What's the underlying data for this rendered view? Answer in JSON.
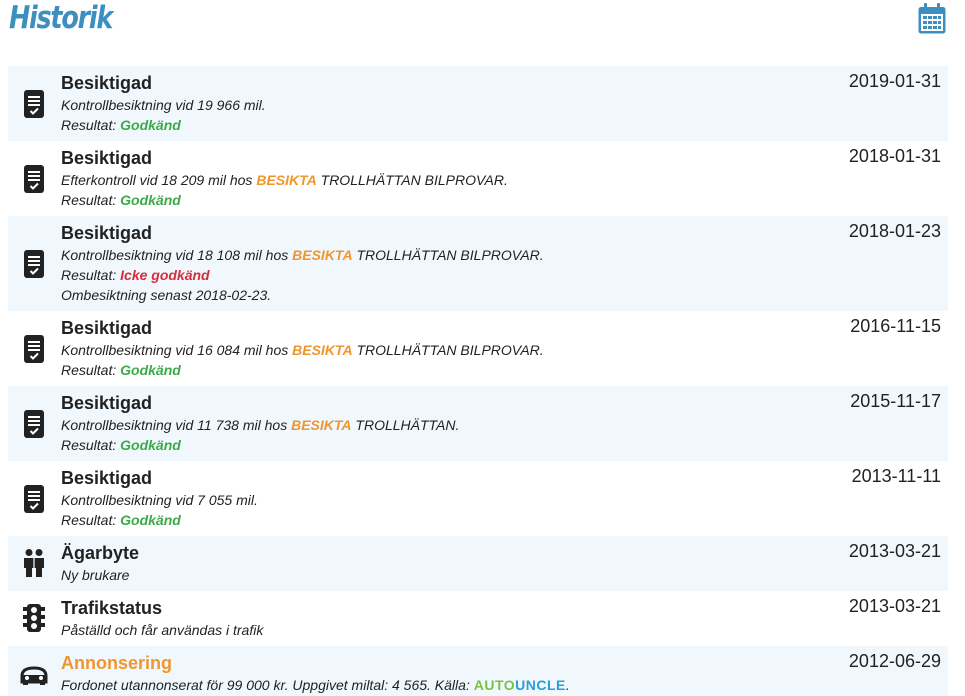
{
  "header": {
    "title": "Historik",
    "calendar_icon": "calendar-icon",
    "accent_color": "#3d8fbf"
  },
  "colors": {
    "ok": "#3daa4a",
    "fail": "#d62d3b",
    "link": "#f0962e",
    "row_alt": "#f0f8fd"
  },
  "events": [
    {
      "title": "Besiktigad",
      "date": "2019-01-31",
      "icon": "checklist-icon",
      "line1": "Kontrollbesiktning vid 19 966 mil.",
      "result_label": "Resultat:",
      "result": "Godkänd"
    },
    {
      "title": "Besiktigad",
      "date": "2018-01-31",
      "icon": "checklist-icon",
      "line1_pre": "Efterkontroll vid 18 209 mil hos",
      "station_link": "BESIKTA",
      "line1_post": "TROLLHÄTTAN BILPROVAR.",
      "result_label": "Resultat:",
      "result": "Godkänd"
    },
    {
      "title": "Besiktigad",
      "date": "2018-01-23",
      "icon": "checklist-icon",
      "line1_pre": "Kontrollbesiktning vid 18 108 mil hos",
      "station_link": "BESIKTA",
      "line1_post": "TROLLHÄTTAN BILPROVAR.",
      "result_label": "Resultat:",
      "result": "Icke godkänd",
      "note": "Ombesiktning senast 2018-02-23."
    },
    {
      "title": "Besiktigad",
      "date": "2016-11-15",
      "icon": "checklist-icon",
      "line1_pre": "Kontrollbesiktning vid 16 084 mil hos",
      "station_link": "BESIKTA",
      "line1_post": "TROLLHÄTTAN BILPROVAR.",
      "result_label": "Resultat:",
      "result": "Godkänd"
    },
    {
      "title": "Besiktigad",
      "date": "2015-11-17",
      "icon": "checklist-icon",
      "line1_pre": "Kontrollbesiktning vid 11 738 mil hos",
      "station_link": "BESIKTA",
      "line1_post": "TROLLHÄTTAN.",
      "result_label": "Resultat:",
      "result": "Godkänd"
    },
    {
      "title": "Besiktigad",
      "date": "2013-11-11",
      "icon": "checklist-icon",
      "line1": "Kontrollbesiktning vid 7 055 mil.",
      "result_label": "Resultat:",
      "result": "Godkänd"
    },
    {
      "title": "Ägarbyte",
      "date": "2013-03-21",
      "icon": "people-icon",
      "line1": "Ny brukare"
    },
    {
      "title": "Trafikstatus",
      "date": "2013-03-21",
      "icon": "traffic-light-icon",
      "line1": "Påställd och får användas i trafik"
    },
    {
      "title": "Annonsering",
      "date": "2012-06-29",
      "icon": "car-icon",
      "line1_pre": "Fordonet utannonserat för 99 000 kr. Uppgivet miltal: 4 565. Källa:",
      "source_auto": "AUTO",
      "source_uncle": "UNCLE",
      "line1_end": "."
    }
  ]
}
